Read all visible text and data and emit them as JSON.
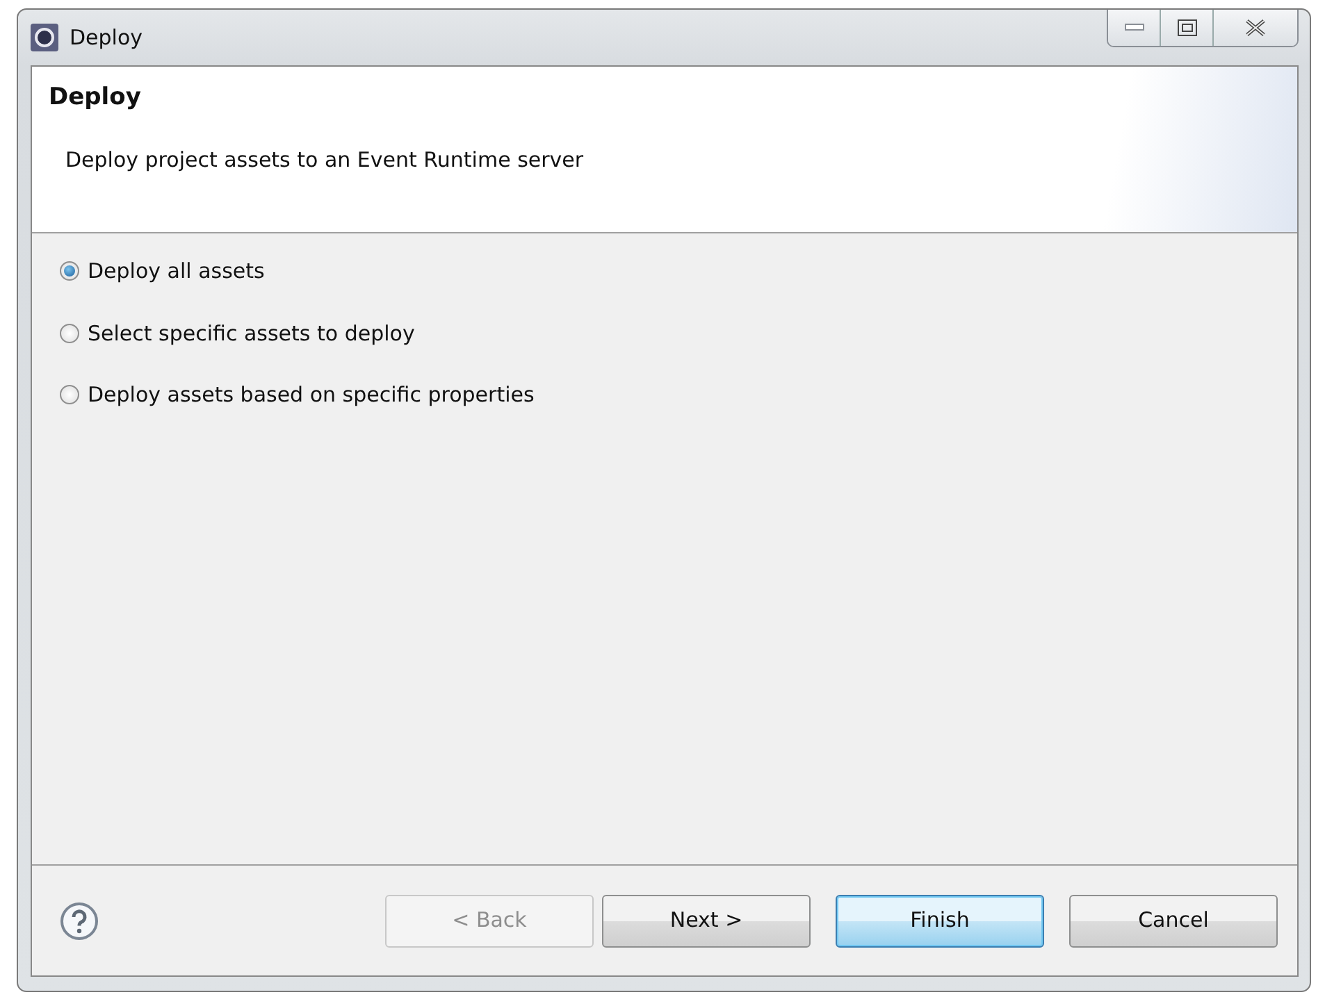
{
  "window": {
    "title": "Deploy"
  },
  "header": {
    "title": "Deploy",
    "description": "Deploy project assets to an Event Runtime server"
  },
  "options": [
    {
      "label": "Deploy all assets",
      "selected": true
    },
    {
      "label": "Select specific assets to deploy",
      "selected": false
    },
    {
      "label": "Deploy assets based on specific properties",
      "selected": false
    }
  ],
  "buttons": [
    {
      "label": "< Back",
      "disabled": true,
      "default": false
    },
    {
      "label": "Next >",
      "disabled": false,
      "default": false
    },
    {
      "label": "Finish",
      "disabled": false,
      "default": true
    },
    {
      "label": "Cancel",
      "disabled": false,
      "default": false
    }
  ]
}
